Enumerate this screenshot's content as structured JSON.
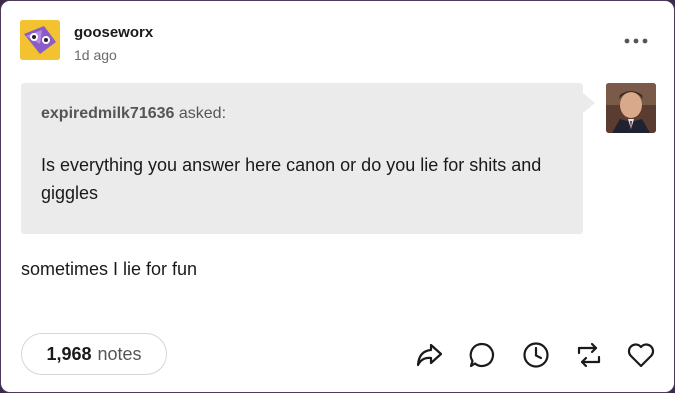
{
  "post": {
    "blog_name": "gooseworx",
    "timestamp": "1d ago",
    "ask": {
      "asker": "expiredmilk71636",
      "asked_label": "asked:",
      "question": "Is everything you answer here canon or do you lie for shits and giggles"
    },
    "answer": "sometimes I lie for fun",
    "notes": {
      "count": "1,968",
      "label": "notes"
    }
  },
  "icons": {
    "more": "more-icon",
    "share": "share-icon",
    "reply": "reply-icon",
    "queue": "clock-icon",
    "reblog": "reblog-icon",
    "like": "heart-icon"
  },
  "colors": {
    "card_bg": "#ffffff",
    "ask_bg": "#ebebeb",
    "text": "#1a1a1a",
    "muted": "#6b6b6b",
    "icon": "#1a1a1a"
  }
}
